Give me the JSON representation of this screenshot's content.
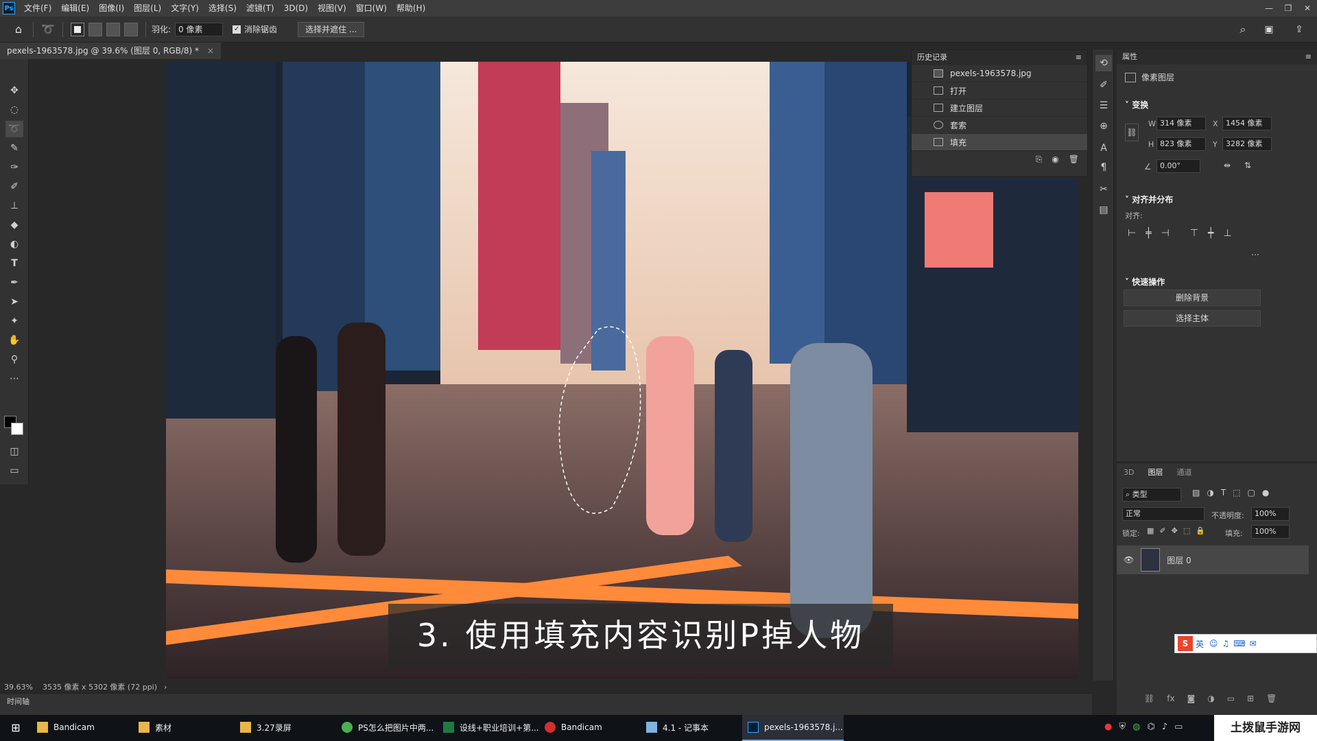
{
  "menubar": {
    "logo": "Ps",
    "items": [
      "文件(F)",
      "编辑(E)",
      "图像(I)",
      "图层(L)",
      "文字(Y)",
      "选择(S)",
      "滤镜(T)",
      "3D(D)",
      "视图(V)",
      "窗口(W)",
      "帮助(H)"
    ]
  },
  "options": {
    "feather_label": "羽化:",
    "feather_value": "0 像素",
    "antialias_label": "消除锯齿",
    "select_mask_button": "选择并遮住 ..."
  },
  "document": {
    "tab_title": "pexels-1963578.jpg @ 39.6% (图层 0, RGB/8) *",
    "caption": "3. 使用填充内容识别P掉人物"
  },
  "status": {
    "zoom": "39.63%",
    "doc_info": "3535 像素 x 5302 像素 (72 ppi)",
    "timeline": "时间轴"
  },
  "history": {
    "title": "历史记录",
    "snapshot": "pexels-1963578.jpg",
    "items": [
      "打开",
      "建立图层",
      "套索",
      "填充"
    ]
  },
  "properties": {
    "title": "属性",
    "layer_type": "像素图层",
    "transform_title": "变换",
    "w_label": "W",
    "w_value": "314 像素",
    "h_label": "H",
    "h_value": "823 像素",
    "x_label": "X",
    "x_value": "1454 像素",
    "y_label": "Y",
    "y_value": "3282 像素",
    "angle_value": "0.00°",
    "align_title": "对齐并分布",
    "align_label": "对齐:",
    "quick_title": "快速操作",
    "remove_bg": "删除背景",
    "select_subject": "选择主体"
  },
  "layers": {
    "tabs": [
      "3D",
      "图层",
      "通道"
    ],
    "filter_kind": "类型",
    "blend_mode": "正常",
    "opacity_label": "不透明度:",
    "opacity_value": "100%",
    "lock_label": "锁定:",
    "fill_label": "填充:",
    "fill_value": "100%",
    "layer_name": "图层 0"
  },
  "ime": {
    "lang": "英"
  },
  "taskbar": {
    "items": [
      {
        "label": "Bandicam",
        "icon": "folder-icon"
      },
      {
        "label": "素材",
        "icon": "folder-icon"
      },
      {
        "label": "3.27录屏",
        "icon": "folder-icon"
      },
      {
        "label": "PS怎么把图片中两...",
        "icon": "browser-icon"
      },
      {
        "label": "设线+职业培训+第...",
        "icon": "excel-icon"
      },
      {
        "label": "Bandicam",
        "icon": "record-icon"
      },
      {
        "label": "4.1 - 记事本",
        "icon": "notepad-icon"
      },
      {
        "label": "pexels-1963578.j...",
        "icon": "photoshop-icon"
      }
    ]
  },
  "watermark": "土拨鼠手游网",
  "colors": {
    "accent": "#31a8ff",
    "panel": "#323232",
    "background": "#282828"
  }
}
